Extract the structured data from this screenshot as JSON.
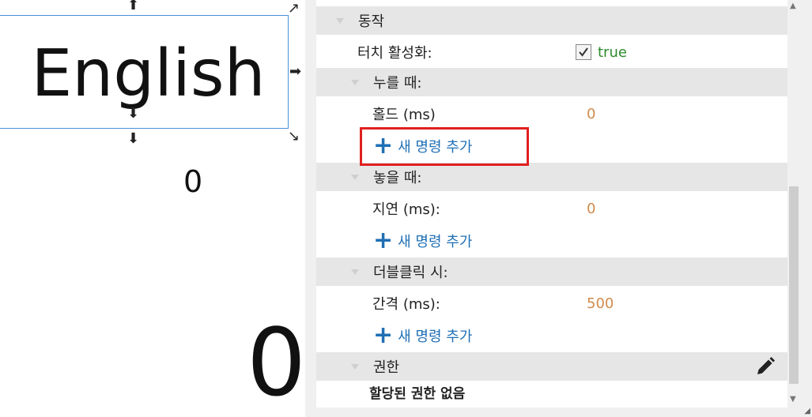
{
  "canvas": {
    "text_widget_label": "English",
    "small_counter": "0",
    "large_counter": "0"
  },
  "panel": {
    "sections": {
      "behavior": {
        "title": "동작",
        "touch_enable_label": "터치 활성화:",
        "touch_enable_value": "true"
      },
      "on_press": {
        "title": "누를 때:",
        "hold_label": "홀드 (ms)",
        "hold_value": "0",
        "add_command": "새 명령 추가"
      },
      "on_release": {
        "title": "놓을 때:",
        "delay_label": "지연 (ms):",
        "delay_value": "0",
        "add_command": "새 명령 추가"
      },
      "on_double_click": {
        "title": "더블클릭 시:",
        "interval_label": "간격 (ms):",
        "interval_value": "500",
        "add_command": "새 명령 추가"
      },
      "permissions": {
        "title": "권한",
        "empty_text": "할당된 권한 없음"
      }
    }
  },
  "icons": {
    "edit": "pencil-icon",
    "add": "plus-icon",
    "check": "check-icon"
  },
  "colors": {
    "accent_blue": "#1f6fb5",
    "value_orange": "#d08b4c",
    "true_green": "#2e8b2e",
    "highlight_red": "#e02020",
    "selection_blue": "#4a90d9"
  }
}
